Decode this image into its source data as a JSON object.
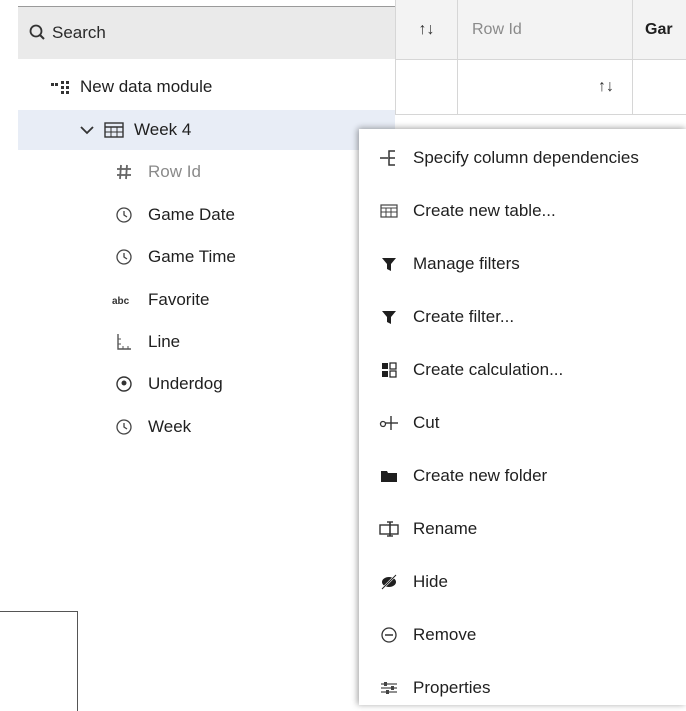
{
  "search": {
    "label": "Search"
  },
  "tree": {
    "module_label": "New data module",
    "table_label": "Week 4",
    "fields": [
      {
        "label": "Row Id",
        "icon": "hash-icon",
        "muted": true
      },
      {
        "label": "Game Date",
        "icon": "clock-icon"
      },
      {
        "label": "Game Time",
        "icon": "clock-icon"
      },
      {
        "label": "Favorite",
        "icon": "abc-icon"
      },
      {
        "label": "Line",
        "icon": "ruler-icon"
      },
      {
        "label": "Underdog",
        "icon": "target-icon"
      },
      {
        "label": "Week",
        "icon": "clock-icon"
      }
    ]
  },
  "grid": {
    "sort_glyph": "↑↓",
    "col_row_id": "Row Id",
    "col_game_partial": "Gar"
  },
  "menu": {
    "items": [
      {
        "label": "Specify column dependencies",
        "icon": "dependency-icon"
      },
      {
        "label": "Create new table...",
        "icon": "table-icon"
      },
      {
        "label": "Manage filters",
        "icon": "filter-icon"
      },
      {
        "label": "Create filter...",
        "icon": "filter-icon"
      },
      {
        "label": "Create calculation...",
        "icon": "calculator-icon"
      },
      {
        "label": "Cut",
        "icon": "scissors-icon"
      },
      {
        "label": "Create new folder",
        "icon": "folder-icon"
      },
      {
        "label": "Rename",
        "icon": "rename-icon"
      },
      {
        "label": "Hide",
        "icon": "hide-icon"
      },
      {
        "label": "Remove",
        "icon": "remove-icon"
      },
      {
        "label": "Properties",
        "icon": "properties-icon"
      }
    ]
  }
}
